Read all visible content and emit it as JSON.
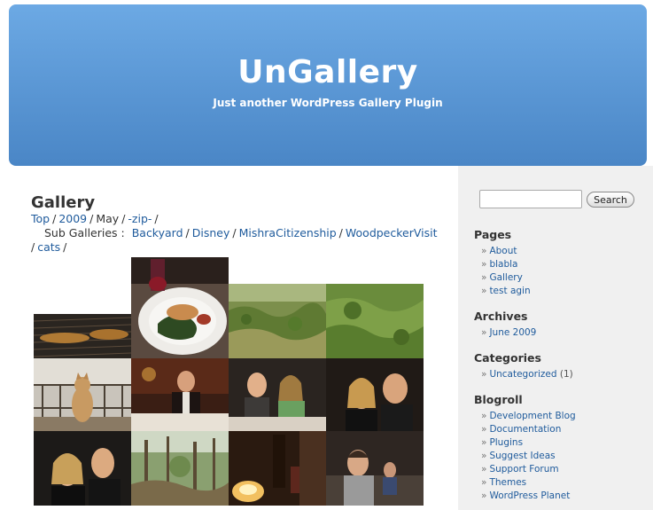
{
  "header": {
    "title": "UnGallery",
    "description": "Just another WordPress Gallery Plugin"
  },
  "main": {
    "title": "Gallery",
    "breadcrumb": {
      "top": "Top",
      "year": "2009",
      "month": "May",
      "zip": "-zip-",
      "sep": "/"
    },
    "sub_galleries": {
      "label": "Sub Galleries :",
      "items": [
        "Backyard",
        "Disney",
        "MishraCitizenship",
        "WoodpeckerVisit",
        "cats"
      ]
    }
  },
  "sidebar": {
    "search_button": "Search",
    "search_value": "",
    "pages_title": "Pages",
    "pages": [
      "About",
      "blabla",
      "Gallery",
      "test agin"
    ],
    "archives_title": "Archives",
    "archives": [
      "June 2009"
    ],
    "categories_title": "Categories",
    "categories": [
      {
        "name": "Uncategorized",
        "count": "(1)"
      }
    ],
    "blogroll_title": "Blogroll",
    "blogroll": [
      "Development Blog",
      "Documentation",
      "Plugins",
      "Suggest Ideas",
      "Support Forum",
      "Themes",
      "WordPress Planet"
    ]
  },
  "colors": {
    "header_top": "#6ca9e4",
    "header_bottom": "#4a86c6",
    "link": "#1f5b9c",
    "sidebar_bg": "#f0f0f0"
  }
}
